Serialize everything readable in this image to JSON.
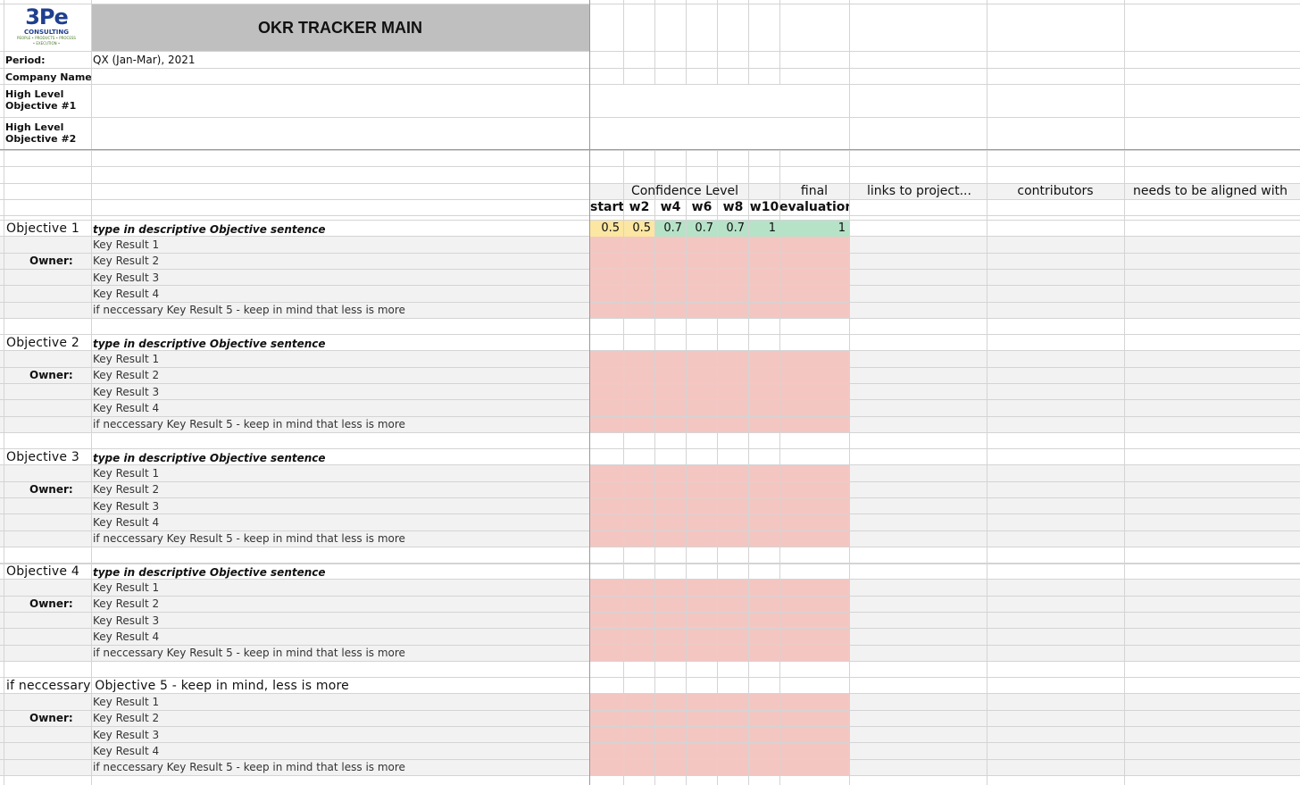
{
  "app": {
    "title": "OKR TRACKER MAIN",
    "logo": {
      "mark": "3Pe",
      "name": "CONSULTING",
      "tagline": "PEOPLE • PRODUCTS • PROCESS",
      "tagline2": "• EXECUTION •"
    }
  },
  "header": {
    "period_label": "Period:",
    "period_value": "QX (Jan-Mar), 2021",
    "company_label": "Company Name:",
    "hlo1_label": "High Level\nObjective #1",
    "hlo2_label": "High Level\nObjective #2"
  },
  "columns": {
    "confidence_label": "Confidence Level",
    "final_label": "final",
    "evaluation_label": "evaluation",
    "weeks": [
      "start",
      "w2",
      "w4",
      "w6",
      "w8",
      "w10"
    ],
    "links_label": "links to project...",
    "contributors_label": "contributors",
    "aligned_label": "needs to be aligned with"
  },
  "objectives": [
    {
      "title": "Objective 1",
      "sentence": "type in descriptive Objective sentence",
      "owner_label": "Owner:",
      "key_results": [
        "Key Result 1",
        "Key Result 2",
        "Key Result 3",
        "Key Result 4",
        "if neccessary Key Result 5 - keep in mind that less is more"
      ],
      "confidence": [
        "0.5",
        "0.5",
        "0.7",
        "0.7",
        "0.7",
        "1"
      ],
      "final": "1"
    },
    {
      "title": "Objective 2",
      "sentence": "type in descriptive Objective sentence",
      "owner_label": "Owner:",
      "key_results": [
        "Key Result 1",
        "Key Result 2",
        "Key Result 3",
        "Key Result 4",
        "if neccessary Key Result 5 - keep in mind that less is more"
      ]
    },
    {
      "title": "Objective 3",
      "sentence": "type in descriptive Objective sentence",
      "owner_label": "Owner:",
      "key_results": [
        "Key Result 1",
        "Key Result 2",
        "Key Result 3",
        "Key Result 4",
        "if neccessary Key Result 5 - keep in mind that less is more"
      ]
    },
    {
      "title": "Objective 4",
      "sentence": "type in descriptive Objective sentence",
      "owner_label": "Owner:",
      "key_results": [
        "Key Result 1",
        "Key Result 2",
        "Key Result 3",
        "Key Result 4",
        "if neccessary Key Result 5 - keep in mind that less is more"
      ]
    },
    {
      "title": "if neccessary Objective 5 - keep in mind, less is more",
      "sentence": "",
      "owner_label": "Owner:",
      "key_results": [
        "Key Result 1",
        "Key Result 2",
        "Key Result 3",
        "Key Result 4",
        "if neccessary Key Result 5 - keep in mind that less is more"
      ]
    }
  ],
  "colors": {
    "title_bg": "#bfbfbf",
    "kr_bg": "#f2f2f2",
    "pink": "#f4c6c2",
    "yellow": "#fbe6a2",
    "green": "#b6e2c8",
    "grid": "#d4d4d4"
  }
}
